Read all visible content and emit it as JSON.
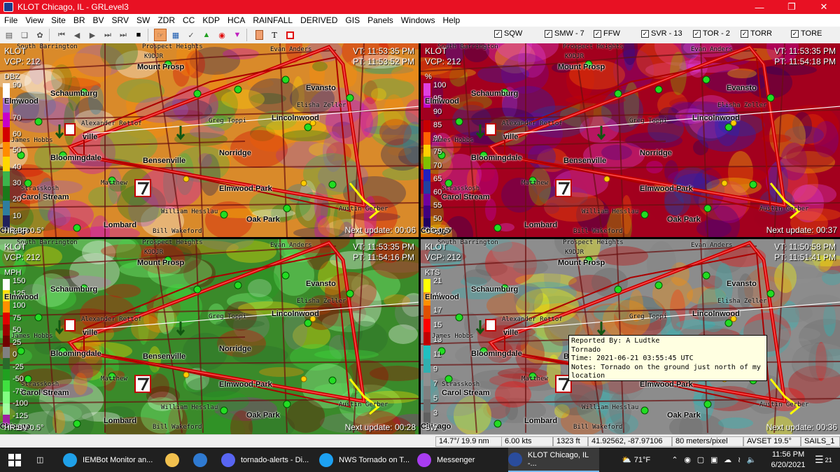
{
  "window": {
    "title": "KLOT Chicago, IL - GRLevel3",
    "minimize_icon": "minimize-icon",
    "maximize_icon": "maximize-icon",
    "close_icon": "close-icon"
  },
  "menu": [
    "File",
    "View",
    "Site",
    "BR",
    "BV",
    "SRV",
    "SW",
    "ZDR",
    "CC",
    "KDP",
    "HCA",
    "RAINFALL",
    "DERIVED",
    "GIS",
    "Panels",
    "Windows",
    "Help"
  ],
  "warnings": [
    {
      "label": "SQW",
      "checked": true
    },
    {
      "label": "SMW - 7",
      "checked": true
    },
    {
      "label": "FFW",
      "checked": true
    },
    {
      "label": "SVR - 13",
      "checked": true
    },
    {
      "label": "TOR - 2",
      "checked": true
    },
    {
      "label": "TORR",
      "checked": true
    },
    {
      "label": "TORE",
      "checked": true
    }
  ],
  "places": {
    "south_barrington": "South Barrington",
    "prospect_heights": "Prospect Heights",
    "k9djr": "K9DJR",
    "evan": "Evan Anders",
    "mount_prospect": "Mount Prosp",
    "schaumburg": "Schaumburg",
    "evanston": "Evansto",
    "elisha": "Elisha Zeller",
    "lincolnwood": "Lincolnwood",
    "alexander": "Alexander Rettof",
    "greg": "Greg Toppi",
    "james": "James Hobbs",
    "wood": "Elmwood",
    "bloomingdale": "Bloomingdale",
    "bensenville": "Bensenville",
    "norridge": "Norridge",
    "elmwood_park": "Elmwood Park",
    "skosh": "Strasskosh",
    "stream": "Carol Stream",
    "matthew": "Matthew",
    "william": "William Hesslau",
    "austin": "Austin Gerber",
    "oak_park": "Oak Park",
    "lombard": "Lombard",
    "bill": "Bill Wakeford",
    "chicago": "Chicago",
    "wheaton": "Wheaton",
    "ville": "ville"
  },
  "panels": [
    {
      "site": "KLOT",
      "vcp": "VCP: 212",
      "vt": "VT: 11:53:35 PM",
      "pt": "PT: 11:53:52 PM",
      "unit": "DBZ",
      "product": "HR BR 0.5°",
      "next": "Next update: 00:06",
      "scale": [
        "90",
        "80",
        "70",
        "60",
        "50",
        "40",
        "30",
        "20",
        "10",
        "0"
      ],
      "legend_colors": [
        "#ffffff",
        "#9955c9",
        "#c800c8",
        "#d40000",
        "#ff8c00",
        "#ffd700",
        "#3cb44b",
        "#1a7a1a",
        "#2e7d9e",
        "#20205a"
      ],
      "bg": "#d98a2a"
    },
    {
      "site": "KLOT",
      "vcp": "VCP: 212",
      "vt": "VT: 11:53:35 PM",
      "pt": "PT: 11:54:18 PM",
      "unit": "%",
      "product": "CC 0.5°",
      "next": "Next update: 00:37",
      "scale": [
        "100",
        "95",
        "90",
        "85",
        "80",
        "75",
        "70",
        "65",
        "60",
        "55",
        "50",
        "45"
      ],
      "legend_colors": [
        "#e040e0",
        "#c000c0",
        "#a00020",
        "#c80000",
        "#ff6000",
        "#ffd000",
        "#80c000",
        "#2020c0",
        "#2040a0",
        "#7000a0",
        "#400080",
        "#200060"
      ],
      "bg": "#a3001e"
    },
    {
      "site": "KLOT",
      "vcp": "VCP: 212",
      "vt": "VT: 11:53:35 PM",
      "pt": "PT: 11:54:16 PM",
      "unit": "MPH",
      "product": "HR BV 0.5°",
      "next": "Next update: 00:28",
      "scale": [
        "150",
        "125",
        "100",
        "75",
        "50",
        "25",
        "0",
        "-25",
        "-50",
        "-75",
        "-100",
        "-125",
        "-150"
      ],
      "legend_colors": [
        "#ffffff",
        "#ffe000",
        "#ff9000",
        "#e00000",
        "#a00000",
        "#700000",
        "#808080",
        "#2a6a2a",
        "#20a020",
        "#40e040",
        "#80ff80",
        "#a0ffa0",
        "#a020a0"
      ],
      "bg": "#3a8a2a"
    },
    {
      "site": "KLOT",
      "vcp": "VCP: 212",
      "vt": "VT: 11:50:58 PM",
      "pt": "PT: 11:51:41 PM",
      "unit": "KTS",
      "product": "SW",
      "next": "Next update: 00:36",
      "scale": [
        "21",
        "19",
        "17",
        "15",
        "13",
        "11",
        "9",
        "7",
        "5",
        "3",
        "1"
      ],
      "legend_colors": [
        "#ffff00",
        "#ff9000",
        "#e05000",
        "#ff0000",
        "#c00000",
        "#20c0c0",
        "#30b0b0",
        "#909090",
        "#808080",
        "#707070",
        "#606060"
      ],
      "bg": "#8c8c8c"
    }
  ],
  "popup": {
    "line1": "Reported By: A Ludtke",
    "line2": "Tornado",
    "line3": "Time: 2021-06-21 03:55:45 UTC",
    "line4": "Notes: Tornado on the ground just north of my",
    "line5": "location"
  },
  "status": {
    "azran": "14.7°/ 19.9 nm",
    "speed": "6.00 kts",
    "height": "1323 ft",
    "latlon": "41.92562, -87.97106",
    "res": "80 meters/pixel",
    "avset": "AVSET 19.5°",
    "sails": "SAILS_1"
  },
  "taskbar": {
    "apps": [
      {
        "label": "IEMBot Monitor an...",
        "icon": "edge-icon",
        "color": "#1fa0e8"
      },
      {
        "label": "",
        "icon": "file-explorer-icon",
        "color": "#f2c14e"
      },
      {
        "label": "",
        "icon": "mail-icon",
        "color": "#2f7ad1"
      },
      {
        "label": "tornado-alerts - Di...",
        "icon": "discord-icon",
        "color": "#5865f2"
      },
      {
        "label": "NWS Tornado on T...",
        "icon": "twitter-icon",
        "color": "#1da1f2"
      },
      {
        "label": "Messenger",
        "icon": "messenger-icon",
        "color": "#a83cf0"
      },
      {
        "label": "KLOT Chicago, IL -...",
        "icon": "grlevel3-icon",
        "color": "#2a4c9c"
      }
    ],
    "weather": "71°F",
    "time": "11:56 PM",
    "date": "6/20/2021",
    "notif": "21"
  }
}
